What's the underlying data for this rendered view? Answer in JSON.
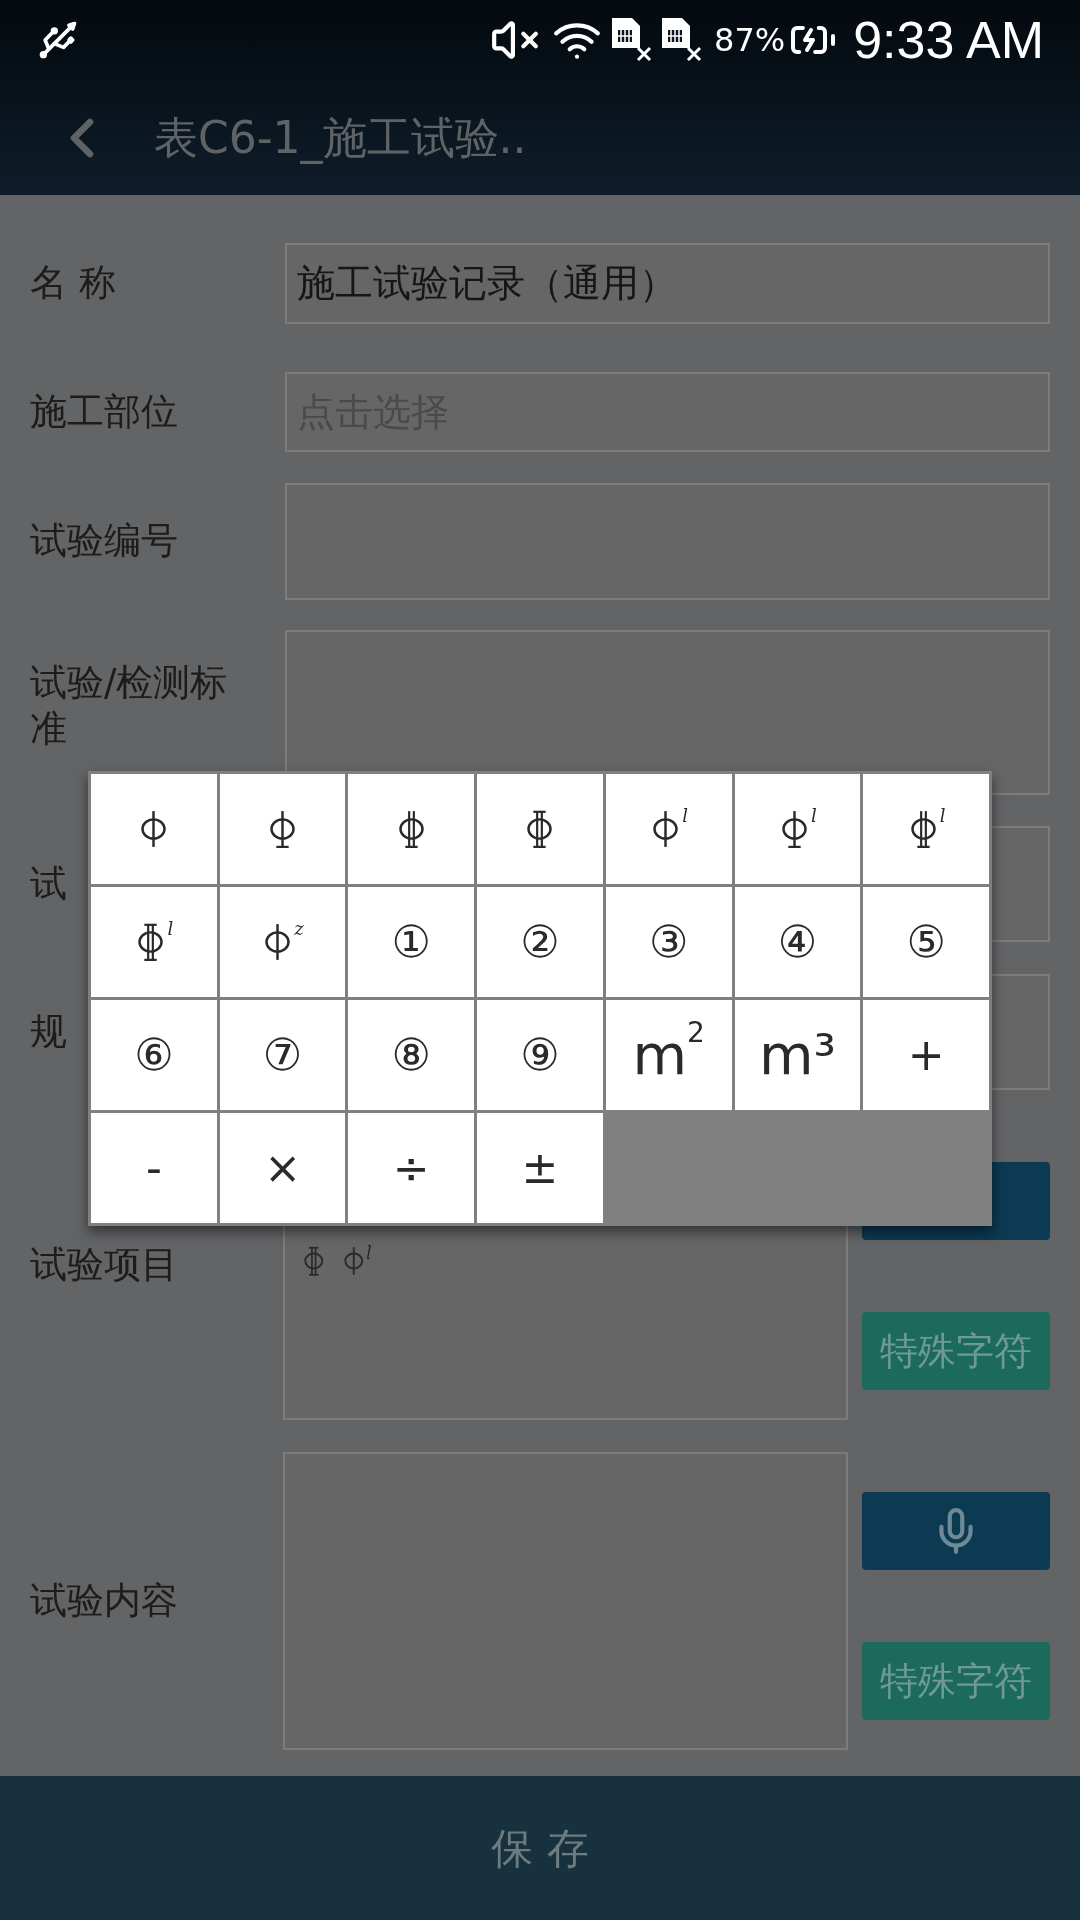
{
  "status_bar": {
    "battery": "87%",
    "time": "9:33 AM"
  },
  "toolbar": {
    "title": "表C6-1_施工试验.."
  },
  "form": {
    "rows": [
      {
        "kind": "field",
        "label": "名 称",
        "value": "施工试验记录（通用）"
      },
      {
        "kind": "field",
        "label": "施工部位",
        "placeholder": "点击选择"
      },
      {
        "kind": "field",
        "label": "试验编号"
      },
      {
        "kind": "field",
        "label": "试验/检测标准"
      },
      {
        "kind": "field",
        "label": "试"
      },
      {
        "kind": "field",
        "label": "规"
      },
      {
        "kind": "textarea",
        "label": "试验项目",
        "tokens": [
          {
            "kind": "phi_boxed"
          },
          {
            "kind": "phi",
            "sup": "l"
          }
        ],
        "button": "特殊字符"
      },
      {
        "kind": "textarea",
        "label": "试验内容",
        "tokens": [],
        "button": "特殊字符"
      }
    ]
  },
  "symbol_popup": {
    "cells": [
      {
        "kind": "phi"
      },
      {
        "kind": "phi_bar"
      },
      {
        "kind": "phi_double"
      },
      {
        "kind": "phi_boxed"
      },
      {
        "kind": "phi",
        "sup": "l"
      },
      {
        "kind": "phi_bar",
        "sup": "l"
      },
      {
        "kind": "phi_double",
        "sup": "l"
      },
      {
        "kind": "phi_boxed",
        "sup": "l"
      },
      {
        "kind": "phi",
        "sup": "z"
      },
      {
        "kind": "text",
        "text": "①"
      },
      {
        "kind": "text",
        "text": "②"
      },
      {
        "kind": "text",
        "text": "③"
      },
      {
        "kind": "text",
        "text": "④"
      },
      {
        "kind": "text",
        "text": "⑤"
      },
      {
        "kind": "text",
        "text": "⑥"
      },
      {
        "kind": "text",
        "text": "⑦"
      },
      {
        "kind": "text",
        "text": "⑧"
      },
      {
        "kind": "text",
        "text": "⑨"
      },
      {
        "kind": "unit",
        "text": "m",
        "sup": "2"
      },
      {
        "kind": "unit",
        "text": "m³"
      },
      {
        "kind": "text",
        "text": "+"
      },
      {
        "kind": "text",
        "text": "-"
      },
      {
        "kind": "text",
        "text": "×"
      },
      {
        "kind": "text",
        "text": "÷"
      },
      {
        "kind": "text",
        "text": "±"
      }
    ]
  },
  "save_button": "保 存"
}
